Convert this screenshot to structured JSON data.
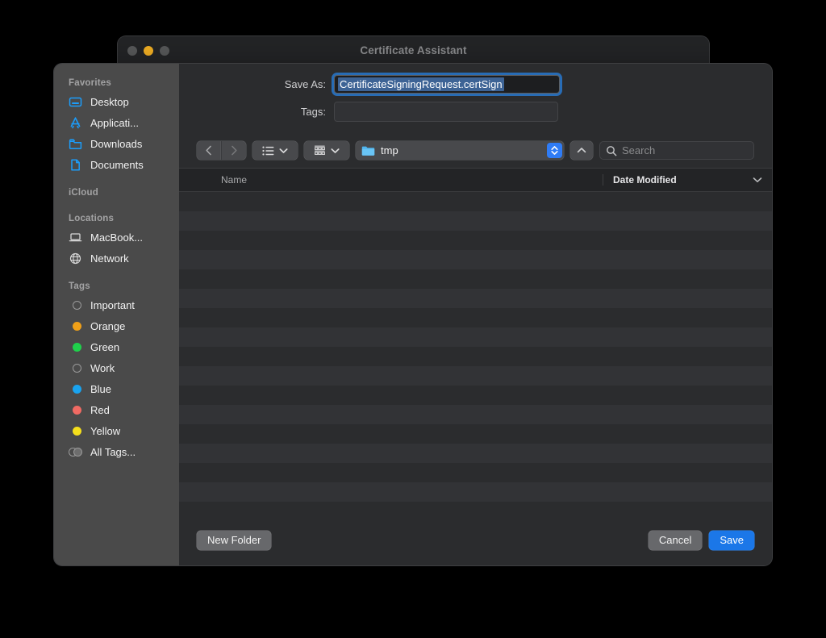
{
  "background_window": {
    "title": "Certificate Assistant",
    "traffic_lights": [
      "close-button",
      "minimize-button",
      "zoom-button"
    ]
  },
  "dialog": {
    "save_as": {
      "label": "Save As:",
      "value": "CertificateSigningRequest.certSign",
      "selected": true
    },
    "tags": {
      "label": "Tags:",
      "value": "",
      "placeholder": ""
    },
    "toolbar": {
      "back_icon": "chevron-left-icon",
      "forward_icon": "chevron-right-icon",
      "list_view_icon": "list-view-icon",
      "icon_view_icon": "icon-view-icon",
      "path_label": "tmp",
      "up_icon": "chevron-up-icon",
      "search_placeholder": "Search",
      "search_value": ""
    },
    "columns": {
      "name": "Name",
      "date_modified": "Date Modified"
    },
    "rows": [],
    "row_count": 16,
    "footer": {
      "new_folder": "New Folder",
      "cancel": "Cancel",
      "save": "Save"
    }
  },
  "sidebar": {
    "sections": [
      {
        "header": "Favorites",
        "items": [
          {
            "label": "Desktop",
            "icon": "desktop-icon"
          },
          {
            "label": "Applicati...",
            "icon": "applications-icon"
          },
          {
            "label": "Downloads",
            "icon": "folder-icon"
          },
          {
            "label": "Documents",
            "icon": "document-icon"
          }
        ]
      },
      {
        "header": "iCloud",
        "items": []
      },
      {
        "header": "Locations",
        "items": [
          {
            "label": "MacBook...",
            "icon": "laptop-icon"
          },
          {
            "label": "Network",
            "icon": "globe-icon"
          }
        ]
      },
      {
        "header": "Tags",
        "items": [
          {
            "label": "Important",
            "icon": "tag-swatch",
            "color": "none"
          },
          {
            "label": "Orange",
            "icon": "tag-swatch",
            "color": "#f0a018"
          },
          {
            "label": "Green",
            "icon": "tag-swatch",
            "color": "#1fd14b"
          },
          {
            "label": "Work",
            "icon": "tag-swatch",
            "color": "none"
          },
          {
            "label": "Blue",
            "icon": "tag-swatch",
            "color": "#19a3ef"
          },
          {
            "label": "Red",
            "icon": "tag-swatch",
            "color": "#f06a63"
          },
          {
            "label": "Yellow",
            "icon": "tag-swatch",
            "color": "#f5df1c"
          },
          {
            "label": "All Tags...",
            "icon": "all-tags-icon",
            "color": "none"
          }
        ]
      }
    ]
  },
  "colors": {
    "accent": "#1b77e8",
    "sidebar_bg": "#4a4a4a",
    "content_bg": "#2b2c2e",
    "titlebar_bg": "#232426",
    "selection_blue": "#3d6395",
    "focus_ring": "#2878cd"
  }
}
